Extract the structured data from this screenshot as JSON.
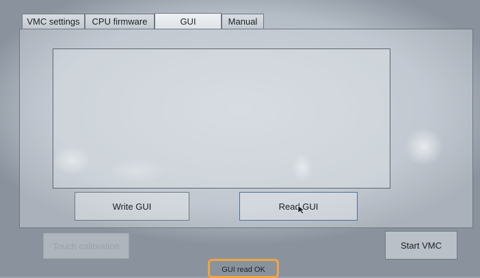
{
  "tabs": [
    {
      "label": "VMC settings",
      "active": false
    },
    {
      "label": "CPU firmware",
      "active": false
    },
    {
      "label": "GUI",
      "active": true
    },
    {
      "label": "Manual",
      "active": false
    }
  ],
  "buttons": {
    "write_gui": "Write GUI",
    "read_gui": "Read GUI",
    "touch_calibration": "Touch calibration",
    "start_vmc": "Start VMC"
  },
  "status": {
    "message": "GUI read OK",
    "highlight_color": "#f2a443"
  },
  "icons": {
    "cursor": "pointer-cursor-icon"
  }
}
